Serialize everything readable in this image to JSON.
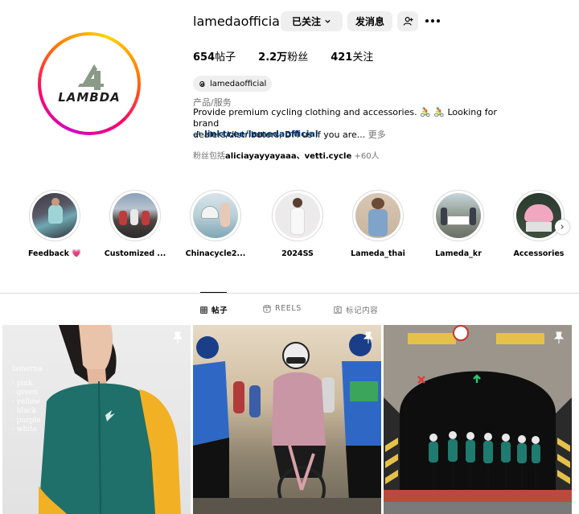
{
  "profile": {
    "username": "lamedaofficial",
    "logo_text": "LAMBDA",
    "posts_count": "654",
    "posts_label": "帖子",
    "followers_count": "2.2万",
    "followers_label": "粉丝",
    "following_count": "421",
    "following_label": "关注",
    "threads_handle": "lamedaofficial",
    "category": "产品/服务",
    "bio_line1": "Provide premium cycling clothing and accessories. 🚴 🚴 Looking for brand",
    "bio_line2": "dealers/distributors, DM us if you are...",
    "bio_more": "更多",
    "link": "linktr.ee/lamedaofficial",
    "followed_by_prefix": "粉丝包括",
    "followed_by_names": "aliciayayyayaaa、vetti.cycle",
    "followed_by_suffix": " +60人"
  },
  "buttons": {
    "following": "已关注",
    "message": "发消息"
  },
  "highlights": [
    {
      "label": "Feedback 💗"
    },
    {
      "label": "Customized ..."
    },
    {
      "label": "Chinacycle2..."
    },
    {
      "label": "2024SS"
    },
    {
      "label": "Lameda_thai"
    },
    {
      "label": "Lameda_kr"
    },
    {
      "label": "Accessories"
    }
  ],
  "tabs": {
    "posts": "帖子",
    "reels": "REELS",
    "tagged": "标记内容"
  },
  "posts": {
    "post1_lines": [
      "lamerna",
      "· pink",
      "· green",
      "· yellow",
      "· black",
      "· purple",
      "· white"
    ]
  },
  "colors": {
    "link": "#00376b",
    "secondary_text": "#737373",
    "button_bg": "#efefef",
    "jersey_teal": "#1f6f6a",
    "jersey_yellow": "#f2b125"
  }
}
